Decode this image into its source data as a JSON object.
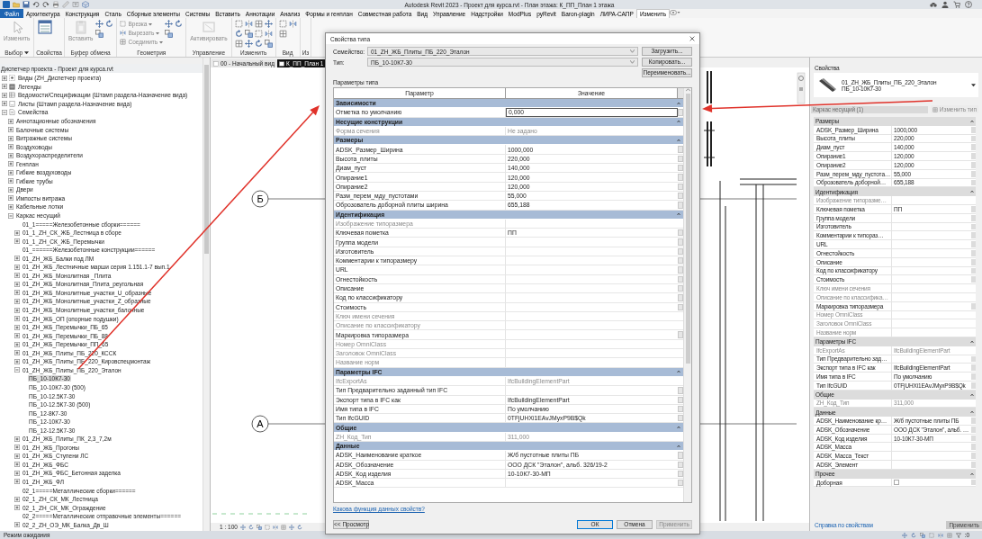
{
  "window": {
    "title": "Autodesk Revit 2023 - Проект для курса.rvt - План этажа: К_ПП_План 1 этажа"
  },
  "ribbon": {
    "file_tab": "Файл",
    "tabs": [
      {
        "label": "Архитектура",
        "selected": false
      },
      {
        "label": "Конструкция",
        "selected": false
      },
      {
        "label": "Сталь",
        "selected": false
      },
      {
        "label": "Сборные элементы",
        "selected": false
      },
      {
        "label": "Системы",
        "selected": false
      },
      {
        "label": "Вставить",
        "selected": false
      },
      {
        "label": "Аннотации",
        "selected": false
      },
      {
        "label": "Анализ",
        "selected": false
      },
      {
        "label": "Формы и генплан",
        "selected": false
      },
      {
        "label": "Совместная работа",
        "selected": false
      },
      {
        "label": "Вид",
        "selected": false
      },
      {
        "label": "Управление",
        "selected": false
      },
      {
        "label": "Надстройки",
        "selected": false
      },
      {
        "label": "ModPlus",
        "selected": false
      },
      {
        "label": "pyRevit",
        "selected": false
      },
      {
        "label": "Baron-plagin",
        "selected": false
      },
      {
        "label": "ЛИРА-САПР",
        "selected": false
      },
      {
        "label": "Изменить",
        "selected": true
      }
    ],
    "panels": [
      {
        "label": "Выбор",
        "dropdown": true,
        "tools": [
          {
            "kind": "large",
            "label": "Изменить",
            "disabled": true
          }
        ]
      },
      {
        "label": "Свойства",
        "dropdown": false,
        "tools": [
          {
            "kind": "large",
            "disabled": false
          }
        ]
      },
      {
        "label": "Буфер обмена",
        "dropdown": false,
        "tools": [
          {
            "kind": "large",
            "label": "Вставить",
            "disabled": true
          },
          {
            "kind": "icon"
          },
          {
            "kind": "icon"
          },
          {
            "kind": "icon"
          }
        ]
      },
      {
        "label": "Геометрия",
        "dropdown": false,
        "tools": [
          {
            "kind": "small",
            "label": "Врезка",
            "disabled": true
          },
          {
            "kind": "small",
            "label": "Вырезать",
            "disabled": true
          },
          {
            "kind": "small",
            "label": "Соединить",
            "disabled": true
          },
          {
            "kind": "icon"
          },
          {
            "kind": "icon"
          },
          {
            "kind": "icon"
          }
        ]
      },
      {
        "label": "Управление",
        "dropdown": false,
        "tools": [
          {
            "kind": "large",
            "label": "Активировать",
            "disabled": true
          }
        ]
      },
      {
        "label": "Изменить",
        "dropdown": false,
        "tools": [
          {
            "kind": "icon"
          },
          {
            "kind": "icon"
          },
          {
            "kind": "icon"
          },
          {
            "kind": "icon"
          },
          {
            "kind": "icon"
          },
          {
            "kind": "icon"
          },
          {
            "kind": "icon"
          },
          {
            "kind": "icon"
          },
          {
            "kind": "icon"
          },
          {
            "kind": "icon"
          },
          {
            "kind": "icon"
          },
          {
            "kind": "icon"
          }
        ]
      },
      {
        "label": "Вид",
        "dropdown": false,
        "tools": [
          {
            "kind": "icon"
          },
          {
            "kind": "icon"
          },
          {
            "kind": "icon"
          }
        ]
      },
      {
        "label": "Из",
        "dropdown": false
      }
    ]
  },
  "project_browser": {
    "title": "Диспетчер проекта - Проект для курса.rvt",
    "tree": [
      {
        "label": "Виды (ZH_Диспетчер проекта)",
        "kind": "folder",
        "expanded": false,
        "selected": false
      },
      {
        "label": "Легенды",
        "kind": "folder",
        "expanded": false,
        "selected": false
      },
      {
        "label": "Ведомости/Спецификации (Штамп раздела-Назначение вида)",
        "kind": "folder",
        "expanded": false,
        "selected": false
      },
      {
        "label": "Листы (Штамп раздела-Назначение вида)",
        "kind": "folder",
        "expanded": false,
        "selected": false
      },
      {
        "label": "Семейства",
        "kind": "folder",
        "expanded": true,
        "selected": false,
        "children": [
          {
            "label": "Аннотационные обозначения",
            "kind": "folder",
            "expanded": false,
            "selected": false
          },
          {
            "label": "Балочные системы",
            "kind": "folder",
            "expanded": false,
            "selected": false
          },
          {
            "label": "Витражные системы",
            "kind": "folder",
            "expanded": false,
            "selected": false
          },
          {
            "label": "Воздуховоды",
            "kind": "folder",
            "expanded": false,
            "selected": false
          },
          {
            "label": "Воздухораспределители",
            "kind": "folder",
            "expanded": false,
            "selected": false
          },
          {
            "label": "Генплан",
            "kind": "folder",
            "expanded": false,
            "selected": false
          },
          {
            "label": "Гибкие воздуховоды",
            "kind": "folder",
            "expanded": false,
            "selected": false
          },
          {
            "label": "Гибкие трубы",
            "kind": "folder",
            "expanded": false,
            "selected": false
          },
          {
            "label": "Двери",
            "kind": "folder",
            "expanded": false,
            "selected": false
          },
          {
            "label": "Импосты витража",
            "kind": "folder",
            "expanded": false,
            "selected": false
          },
          {
            "label": "Кабельные лотки",
            "kind": "folder",
            "expanded": false,
            "selected": false
          },
          {
            "label": "Каркас несущий",
            "kind": "folder",
            "expanded": true,
            "selected": false,
            "children": [
              {
                "label": "01_1=====Железобетонные сборки======",
                "kind": "leaf",
                "selected": false
              },
              {
                "label": "01_1_ZH_СК_ЖБ_Лестница в сборе",
                "kind": "folder",
                "expanded": false,
                "selected": false
              },
              {
                "label": "01_1_ZH_СК_ЖБ_Перемычки",
                "kind": "folder",
                "expanded": false,
                "selected": false
              },
              {
                "label": "01_======Железобетонные конструкции======",
                "kind": "leaf",
                "selected": false
              },
              {
                "label": "01_ZH_ЖБ_Балки под ЛМ",
                "kind": "folder",
                "expanded": false,
                "selected": false
              },
              {
                "label": "01_ZH_ЖБ_Лестничные марши серия 1.151.1-7 вып.1",
                "kind": "folder",
                "expanded": false,
                "selected": false
              },
              {
                "label": "01_ZH_ЖБ_Монолитная _Плита",
                "kind": "folder",
                "expanded": false,
                "selected": false
              },
              {
                "label": "01_ZH_ЖБ_Монолитная_Плита_реугольная",
                "kind": "folder",
                "expanded": false,
                "selected": false
              },
              {
                "label": "01_ZH_ЖБ_Монолитные_участки_U_образные",
                "kind": "folder",
                "expanded": false,
                "selected": false
              },
              {
                "label": "01_ZH_ЖБ_Монолитные_участки_Z_образные",
                "kind": "folder",
                "expanded": false,
                "selected": false
              },
              {
                "label": "01_ZH_ЖБ_Монолитные_участки_балочные",
                "kind": "folder",
                "expanded": false,
                "selected": false
              },
              {
                "label": "01_ZH_ЖБ_ОП (опорные подушки)",
                "kind": "folder",
                "expanded": false,
                "selected": false
              },
              {
                "label": "01_ZH_ЖБ_Перемычки_ПБ_65",
                "kind": "folder",
                "expanded": false,
                "selected": false
              },
              {
                "label": "01_ZH_ЖБ_Перемычки_ПБ_88",
                "kind": "folder",
                "expanded": false,
                "selected": false
              },
              {
                "label": "01_ZH_ЖБ_Перемычки_ПП_65",
                "kind": "folder",
                "expanded": false,
                "selected": false
              },
              {
                "label": "01_ZH_ЖБ_Плиты_ПБ_220_КССК",
                "kind": "folder",
                "expanded": false,
                "selected": false
              },
              {
                "label": "01_ZH_ЖБ_Плиты_ПБ_220_Кировспецмонтаж",
                "kind": "folder",
                "expanded": false,
                "selected": false
              },
              {
                "label": "01_ZH_ЖБ_Плиты_ПБ_220_Эталон",
                "kind": "folder",
                "expanded": true,
                "selected": false,
                "children": [
                  {
                    "label": "ПБ_10-10К7-30",
                    "kind": "leaf",
                    "selected": true
                  },
                  {
                    "label": "ПБ_10-10К7-30 (500)",
                    "kind": "leaf",
                    "selected": false
                  },
                  {
                    "label": "ПБ_10-12.5К7-30",
                    "kind": "leaf",
                    "selected": false
                  },
                  {
                    "label": "ПБ_10-12.5К7-30 (500)",
                    "kind": "leaf",
                    "selected": false
                  },
                  {
                    "label": "ПБ_12-8К7-30",
                    "kind": "leaf",
                    "selected": false
                  },
                  {
                    "label": "ПБ_12-10К7-30",
                    "kind": "leaf",
                    "selected": false
                  },
                  {
                    "label": "ПБ_12-12.5К7-30",
                    "kind": "leaf",
                    "selected": false
                  }
                ]
              },
              {
                "label": "01_ZH_ЖБ_Плиты_ПК_2,3_7,2м",
                "kind": "folder",
                "expanded": false,
                "selected": false
              },
              {
                "label": "01_ZH_ЖБ_Прогоны",
                "kind": "folder",
                "expanded": false,
                "selected": false
              },
              {
                "label": "01_ZH_ЖБ_Ступени ЛС",
                "kind": "folder",
                "expanded": false,
                "selected": false
              },
              {
                "label": "01_ZH_ЖБ_ФБС",
                "kind": "folder",
                "expanded": false,
                "selected": false
              },
              {
                "label": "01_ZH_ЖБ_ФБС_Бетонная заделка",
                "kind": "folder",
                "expanded": false,
                "selected": false
              },
              {
                "label": "01_ZH_ЖБ_ФЛ",
                "kind": "folder",
                "expanded": false,
                "selected": false
              },
              {
                "label": "02_1=====Металлические сборки======",
                "kind": "leaf",
                "selected": false
              },
              {
                "label": "02_1_ZH_СК_МК_Лестница",
                "kind": "folder",
                "expanded": false,
                "selected": false
              },
              {
                "label": "02_1_ZH_СК_МК_Ограждение",
                "kind": "folder",
                "expanded": false,
                "selected": false
              },
              {
                "label": "02_2=====Металлические отправочные элементы======",
                "kind": "leaf",
                "selected": false
              },
              {
                "label": "02_2_ZH_ОЭ_МК_Балка_Дв_Ш",
                "kind": "folder",
                "expanded": false,
                "selected": false
              }
            ]
          }
        ]
      }
    ]
  },
  "view": {
    "tabs": [
      {
        "label": "00 - Начальный вид",
        "selected": false
      },
      {
        "label": "К_ПП_План 1",
        "selected": true
      }
    ],
    "grids": [
      {
        "label": "Б"
      },
      {
        "label": "А"
      }
    ],
    "scale": "1 : 100"
  },
  "properties": {
    "title": "Свойства",
    "type_family": "01_ZH_ЖБ_Плиты_ПБ_220_Эталон",
    "type_name": "ПБ_10-10К7-30",
    "instance_filter": "Каркас несущий (1)",
    "edit_type": "Изменить тип",
    "edit_type_disabled": true,
    "groups": [
      {
        "name": "Размеры",
        "rows": [
          {
            "kind": "text",
            "param": "ADSK_Размер_Ширина",
            "value": "1000,000",
            "disabled": false
          },
          {
            "kind": "text",
            "param": "Высота_плиты",
            "value": "220,000",
            "disabled": false
          },
          {
            "kind": "text",
            "param": "Диам_пуст",
            "value": "140,000",
            "disabled": false
          },
          {
            "kind": "text",
            "param": "Опирание1",
            "value": "120,000",
            "disabled": false
          },
          {
            "kind": "text",
            "param": "Опирание2",
            "value": "120,000",
            "disabled": false
          },
          {
            "kind": "text",
            "param": "Разм_перем_мду_пустота…",
            "value": "55,000",
            "disabled": false
          },
          {
            "kind": "text",
            "param": "Оброзователь доборной…",
            "value": "655,188",
            "disabled": false
          }
        ]
      },
      {
        "name": "Идентификация",
        "rows": [
          {
            "kind": "text",
            "param": "Изображение типоразме…",
            "disabled": true
          },
          {
            "kind": "text",
            "param": "Ключевая пометка",
            "value": "ПП",
            "disabled": false
          },
          {
            "kind": "text",
            "param": "Группа модели",
            "disabled": false
          },
          {
            "kind": "text",
            "param": "Изготовитель",
            "disabled": false
          },
          {
            "kind": "text",
            "param": "Комментарии к типораз…",
            "disabled": false
          },
          {
            "kind": "text",
            "param": "URL",
            "disabled": false
          },
          {
            "kind": "text",
            "param": "Огнестойкость",
            "disabled": false
          },
          {
            "kind": "text",
            "param": "Описание",
            "disabled": false
          },
          {
            "kind": "text",
            "param": "Код по классификатору",
            "disabled": false
          },
          {
            "kind": "text",
            "param": "Стоимость",
            "disabled": false
          },
          {
            "kind": "text",
            "param": "Ключ имени сечения",
            "disabled": true
          },
          {
            "kind": "text",
            "param": "Описание по классифика…",
            "disabled": true
          },
          {
            "kind": "text",
            "param": "Маркировка типоразмера",
            "disabled": false
          },
          {
            "kind": "text",
            "param": "Номер OmniClass",
            "disabled": true
          },
          {
            "kind": "text",
            "param": "Заголовок OmniClass",
            "disabled": true
          },
          {
            "kind": "text",
            "param": "Название норм",
            "disabled": true
          }
        ]
      },
      {
        "name": "Параметры IFC",
        "rows": [
          {
            "kind": "text",
            "param": "IfcExportAs",
            "value": "IfcBuildingElementPart",
            "disabled": true
          },
          {
            "kind": "text",
            "param": "Тип Предварительно зад…",
            "disabled": false
          },
          {
            "kind": "text",
            "param": "Экспорт типа в IFC как",
            "value": "IfcBuildingElementPart",
            "disabled": false
          },
          {
            "kind": "text",
            "param": "Имя типа в IFC",
            "value": "По умолчанию",
            "disabled": false
          },
          {
            "kind": "text",
            "param": "Тип IfcGUID",
            "value": "0TFjUHXi1EAvJMyxP9B$Qk",
            "disabled": false
          }
        ]
      },
      {
        "name": "Общие",
        "rows": [
          {
            "kind": "text",
            "param": "ZH_Код_Тип",
            "value": "311,000",
            "disabled": true
          }
        ]
      },
      {
        "name": "Данные",
        "rows": [
          {
            "kind": "text",
            "param": "ADSK_Наименование кр…",
            "value": "Ж/б пустотные плиты ПБ",
            "disabled": false
          },
          {
            "kind": "text",
            "param": "ADSK_Обозначение",
            "value": "ООО ДСК \"Эталон\", альб. …",
            "disabled": false
          },
          {
            "kind": "text",
            "param": "ADSK_Код изделия",
            "value": "10-10К7-30-МП",
            "disabled": false
          },
          {
            "kind": "text",
            "param": "ADSK_Масса",
            "disabled": false
          },
          {
            "kind": "text",
            "param": "ADSK_Масса_Текст",
            "disabled": false
          },
          {
            "kind": "text",
            "param": "ADSK_Элемент",
            "disabled": false
          }
        ]
      },
      {
        "name": "Прочее",
        "rows": [
          {
            "kind": "checkbox",
            "param": "Доборная",
            "checked": false,
            "disabled": false
          }
        ]
      }
    ],
    "help_link": "Справка по свойствам",
    "apply": "Применить"
  },
  "dialog": {
    "title": "Свойства типа",
    "family_label": "Семейство:",
    "family": "01_ZH_ЖБ_Плиты_ПБ_220_Эталон",
    "load": "Загрузить...",
    "type_label": "Тип:",
    "type": "ПБ_10-10К7-30",
    "duplicate": "Копировать...",
    "rename": "Переименовать...",
    "params_label": "Параметры типа",
    "columns": [
      "Параметр",
      "Значение"
    ],
    "groups": [
      {
        "name": "Зависимости",
        "rows": [
          {
            "param": "Отметка по умолчанию",
            "value": "0,000",
            "disabled": false,
            "selected": true
          }
        ]
      },
      {
        "name": "Несущие конструкции",
        "rows": [
          {
            "param": "Форма сечения",
            "value": "Не задано",
            "disabled": true,
            "selected": false
          }
        ]
      },
      {
        "name": "Размеры",
        "rows": [
          {
            "param": "ADSK_Размер_Ширина",
            "value": "1000,000",
            "disabled": false,
            "selected": false
          },
          {
            "param": "Высота_плиты",
            "value": "220,000",
            "disabled": false,
            "selected": false
          },
          {
            "param": "Диам_пуст",
            "value": "140,000",
            "disabled": false,
            "selected": false
          },
          {
            "param": "Опирание1",
            "value": "120,000",
            "disabled": false,
            "selected": false
          },
          {
            "param": "Опирание2",
            "value": "120,000",
            "disabled": false,
            "selected": false
          },
          {
            "param": "Разм_перем_мду_пустотами",
            "value": "55,000",
            "disabled": false,
            "selected": false
          },
          {
            "param": "Оброзователь доборной плиты ширина",
            "value": "655,188",
            "disabled": false,
            "selected": false
          }
        ]
      },
      {
        "name": "Идентификация",
        "rows": [
          {
            "param": "Изображение типоразмера",
            "disabled": true,
            "selected": false
          },
          {
            "param": "Ключевая пометка",
            "value": "ПП",
            "disabled": false,
            "selected": false
          },
          {
            "param": "Группа модели",
            "disabled": false,
            "selected": false
          },
          {
            "param": "Изготовитель",
            "disabled": false,
            "selected": false
          },
          {
            "param": "Комментарии к типоразмеру",
            "disabled": false,
            "selected": false
          },
          {
            "param": "URL",
            "disabled": false,
            "selected": false
          },
          {
            "param": "Огнестойкость",
            "disabled": false,
            "selected": false
          },
          {
            "param": "Описание",
            "disabled": false,
            "selected": false
          },
          {
            "param": "Код по классификатору",
            "disabled": false,
            "selected": false
          },
          {
            "param": "Стоимость",
            "disabled": false,
            "selected": false
          },
          {
            "param": "Ключ имени сечения",
            "disabled": true,
            "selected": false
          },
          {
            "param": "Описание по классификатору",
            "disabled": true,
            "selected": false
          },
          {
            "param": "Маркировка типоразмера",
            "disabled": false,
            "selected": false
          },
          {
            "param": "Номер OmniClass",
            "disabled": true,
            "selected": false
          },
          {
            "param": "Заголовок OmniClass",
            "disabled": true,
            "selected": false
          },
          {
            "param": "Название норм",
            "disabled": true,
            "selected": false
          }
        ]
      },
      {
        "name": "Параметры IFC",
        "rows": [
          {
            "param": "IfcExportAs",
            "value": "IfcBuildingElementPart",
            "disabled": true,
            "selected": false
          },
          {
            "param": "Тип Предварительно заданный тип IFC",
            "disabled": false,
            "selected": false
          },
          {
            "param": "Экспорт типа в IFC как",
            "value": "IfcBuildingElementPart",
            "disabled": false,
            "selected": false
          },
          {
            "param": "Имя типа в IFC",
            "value": "По умолчанию",
            "disabled": false,
            "selected": false
          },
          {
            "param": "Тип IfcGUID",
            "value": "0TFjUHXi1EAvJMyxP9B$Qk",
            "disabled": false,
            "selected": false
          }
        ]
      },
      {
        "name": "Общие",
        "rows": [
          {
            "param": "ZH_Код_Тип",
            "value": "311,000",
            "disabled": true,
            "selected": false
          }
        ]
      },
      {
        "name": "Данные",
        "rows": [
          {
            "param": "ADSK_Наименование краткое",
            "value": "Ж/б пустотные плиты ПБ",
            "disabled": false,
            "selected": false
          },
          {
            "param": "ADSK_Обозначение",
            "value": "ООО ДСК \"Эталон\", альб. 326/19-2",
            "disabled": false,
            "selected": false
          },
          {
            "param": "ADSK_Код изделия",
            "value": "10-10К7-30-МП",
            "disabled": false,
            "selected": false
          },
          {
            "param": "ADSK_Масса",
            "disabled": false,
            "selected": false
          }
        ]
      }
    ],
    "help_link": "Какова функция данных свойств?",
    "preview": "<< Просмотр",
    "ok": "ОК",
    "cancel": "Отмена",
    "apply": "Применить",
    "apply_disabled": true
  },
  "status_bar": {
    "text": "Режим ожидания",
    "filter_count": ":0"
  },
  "markup": [
    {
      "kind": "arrow"
    },
    {
      "kind": "arrow"
    }
  ]
}
